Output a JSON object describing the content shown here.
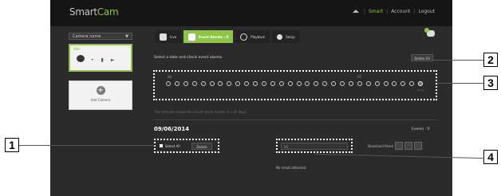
{
  "app": {
    "logo": {
      "part1": "Smart",
      "part2": "Cam"
    },
    "toplinks": [
      "Smart",
      "Account",
      "Logout"
    ]
  },
  "sidebar": {
    "dropdown_label": "Camera name",
    "camera_name": "SNH",
    "add_label": "Add Camera"
  },
  "tabs": [
    {
      "label": "Live"
    },
    {
      "label": "Event Alarms : 0"
    },
    {
      "label": "Playback"
    },
    {
      "label": "Setup"
    }
  ],
  "calendar": {
    "prompt": "Select a date and check event alarms.",
    "delete_all": "Delete All",
    "month_a": "06",
    "month_b": "07",
    "today_label": "Today",
    "day_count": 30
  },
  "hint": "The calendar shows the recent alarm events in a 30 days.",
  "events_panel": {
    "date": "09/06/2014",
    "events_count": "Events : 0",
    "select_all": "Select All",
    "delete": "Delete",
    "time_placeholder": "All",
    "thumbnail_label": "Download Panel",
    "no_result": "No result detected."
  },
  "callouts": [
    "1",
    "2",
    "3",
    "4"
  ]
}
